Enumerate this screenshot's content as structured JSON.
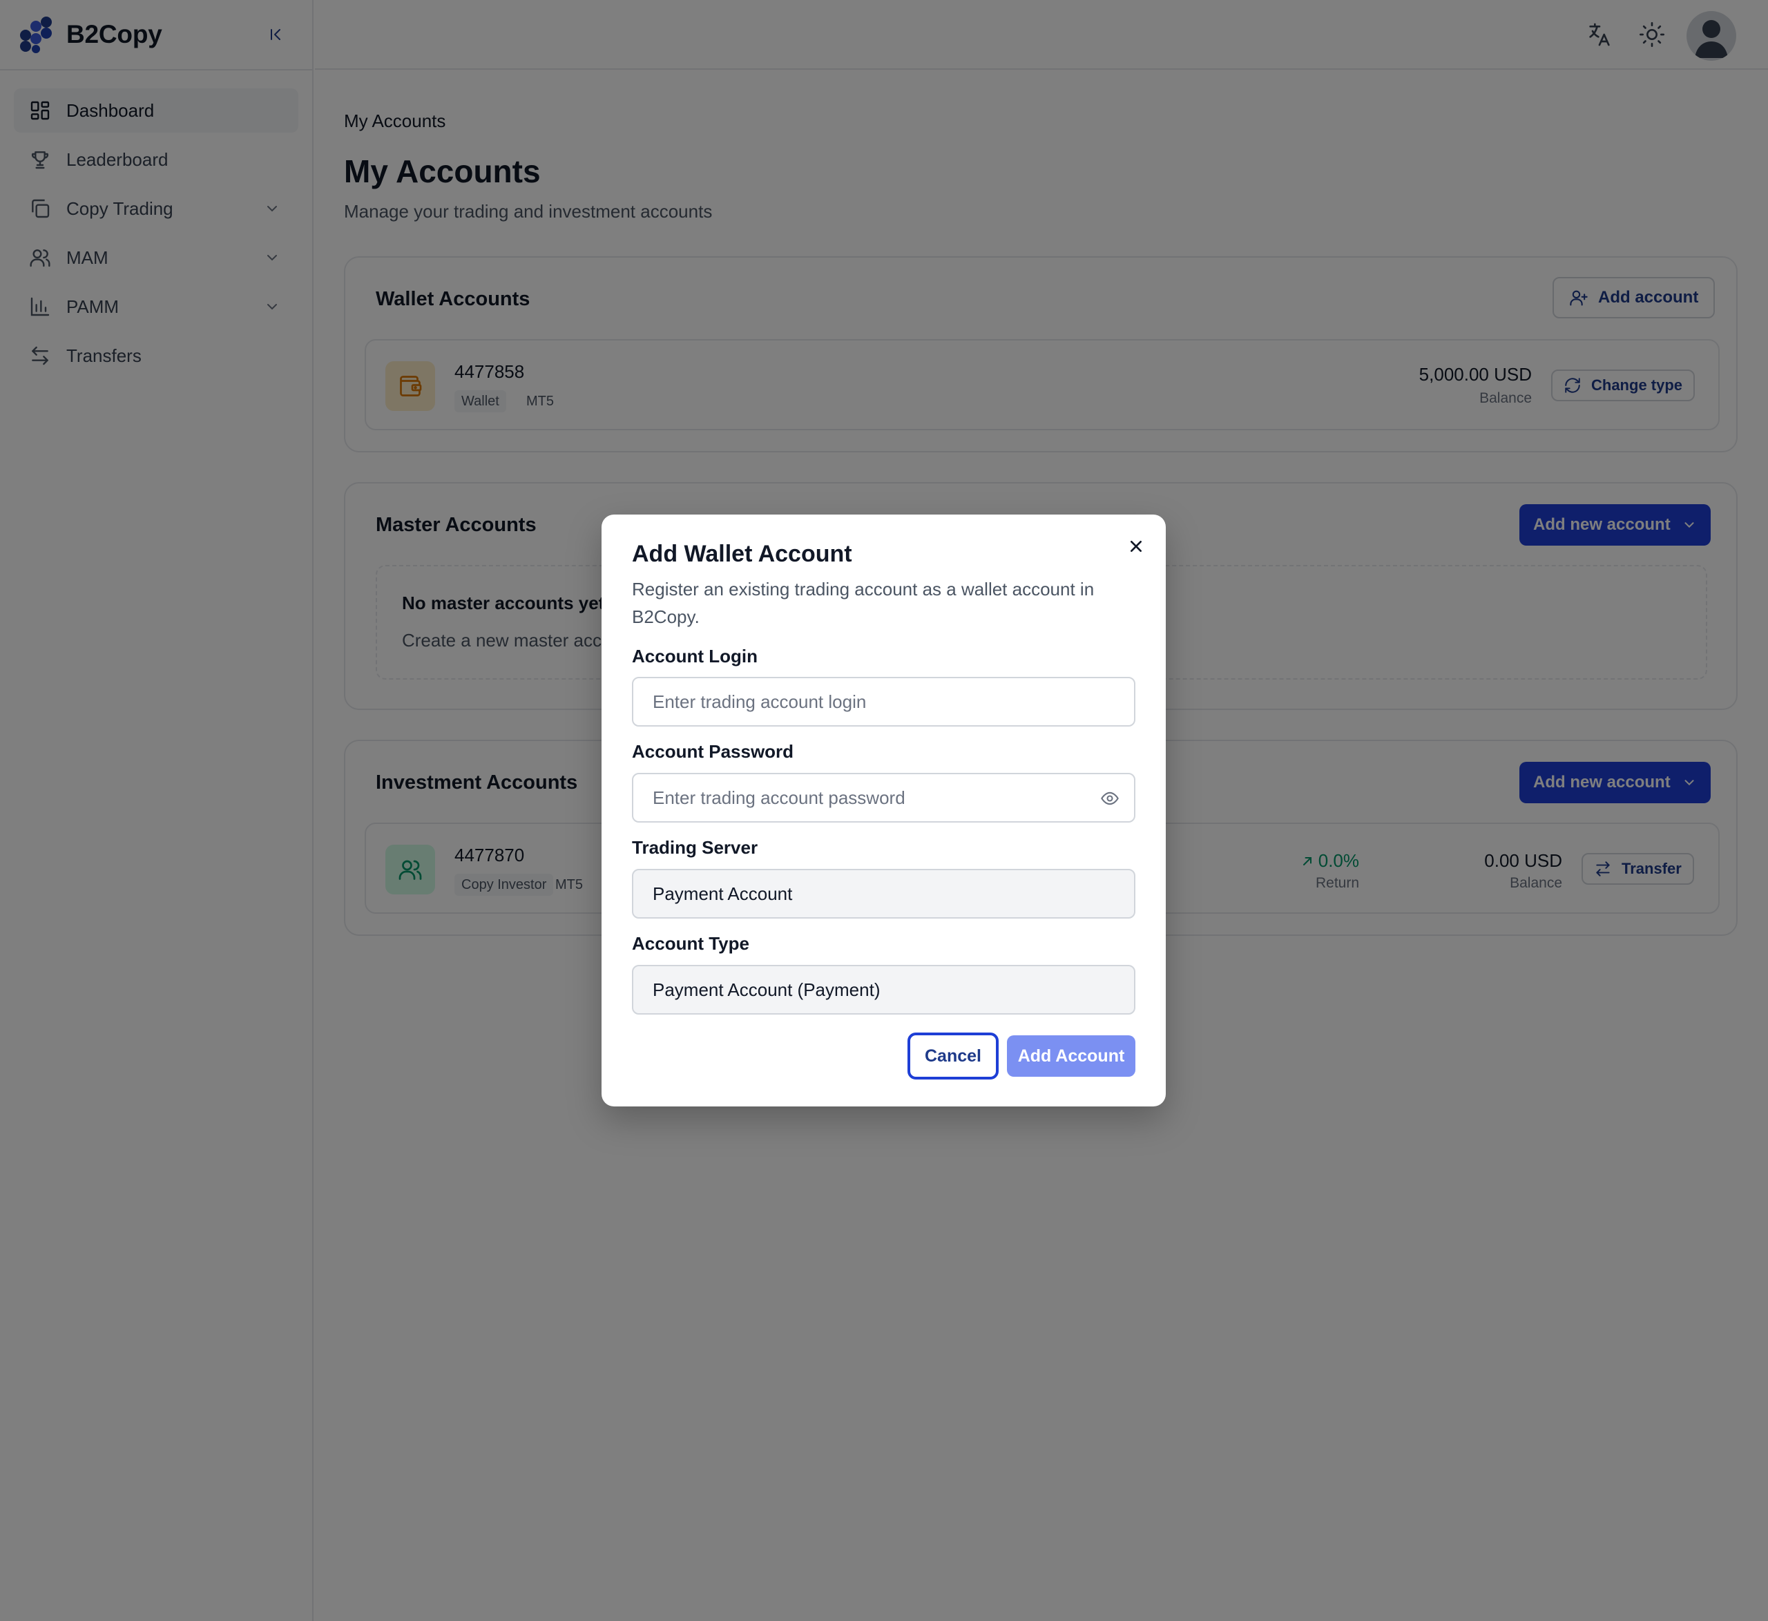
{
  "app": {
    "name": "B2Copy"
  },
  "sidebar": {
    "items": [
      {
        "label": "Dashboard",
        "icon": "dashboard-icon",
        "active": true
      },
      {
        "label": "Leaderboard",
        "icon": "trophy-icon"
      },
      {
        "label": "Copy Trading",
        "icon": "copy-icon",
        "has_submenu": true
      },
      {
        "label": "MAM",
        "icon": "users-icon",
        "has_submenu": true
      },
      {
        "label": "PAMM",
        "icon": "bar-chart-icon",
        "has_submenu": true
      },
      {
        "label": "Transfers",
        "icon": "transfer-arrows-icon"
      }
    ]
  },
  "header": {
    "icons": [
      "translate-icon",
      "sun-icon",
      "user-avatar"
    ]
  },
  "page": {
    "breadcrumb": "My Accounts",
    "title": "My Accounts",
    "subtitle": "Manage your trading and investment accounts"
  },
  "wallet": {
    "title": "Wallet Accounts",
    "add_label": "Add account",
    "account": {
      "number": "4477858",
      "tag1": "Wallet",
      "tag2": "MT5",
      "balance": "5,000.00 USD",
      "balance_label": "Balance",
      "action_label": "Change type"
    }
  },
  "master": {
    "title": "Master Accounts",
    "add_label": "Add new account",
    "empty_title": "No master accounts yet",
    "empty_desc": "Create a new master acc"
  },
  "investment": {
    "title": "Investment Accounts",
    "add_label": "Add new account",
    "account": {
      "number": "4477870",
      "tag1": "Copy Investor",
      "tag2": "MT5",
      "return_value": "0.0%",
      "return_label": "Return",
      "balance": "0.00 USD",
      "balance_label": "Balance",
      "action_label": "Transfer"
    }
  },
  "modal": {
    "title": "Add Wallet Account",
    "description": "Register an existing trading account as a wallet account in B2Copy.",
    "login_label": "Account Login",
    "login_placeholder": "Enter trading account login",
    "password_label": "Account Password",
    "password_placeholder": "Enter trading account password",
    "server_label": "Trading Server",
    "server_value": "Payment Account",
    "type_label": "Account Type",
    "type_value": "Payment Account (Payment)",
    "cancel_label": "Cancel",
    "submit_label": "Add Account"
  },
  "colors": {
    "primary": "#1e3fd6",
    "primary_disabled": "#7b90f2",
    "wallet_icon_bg": "#fdecc8",
    "wallet_icon": "#d97706",
    "investor_icon_bg": "#d1fae5",
    "investor_icon": "#059669",
    "return_positive": "#059669"
  }
}
